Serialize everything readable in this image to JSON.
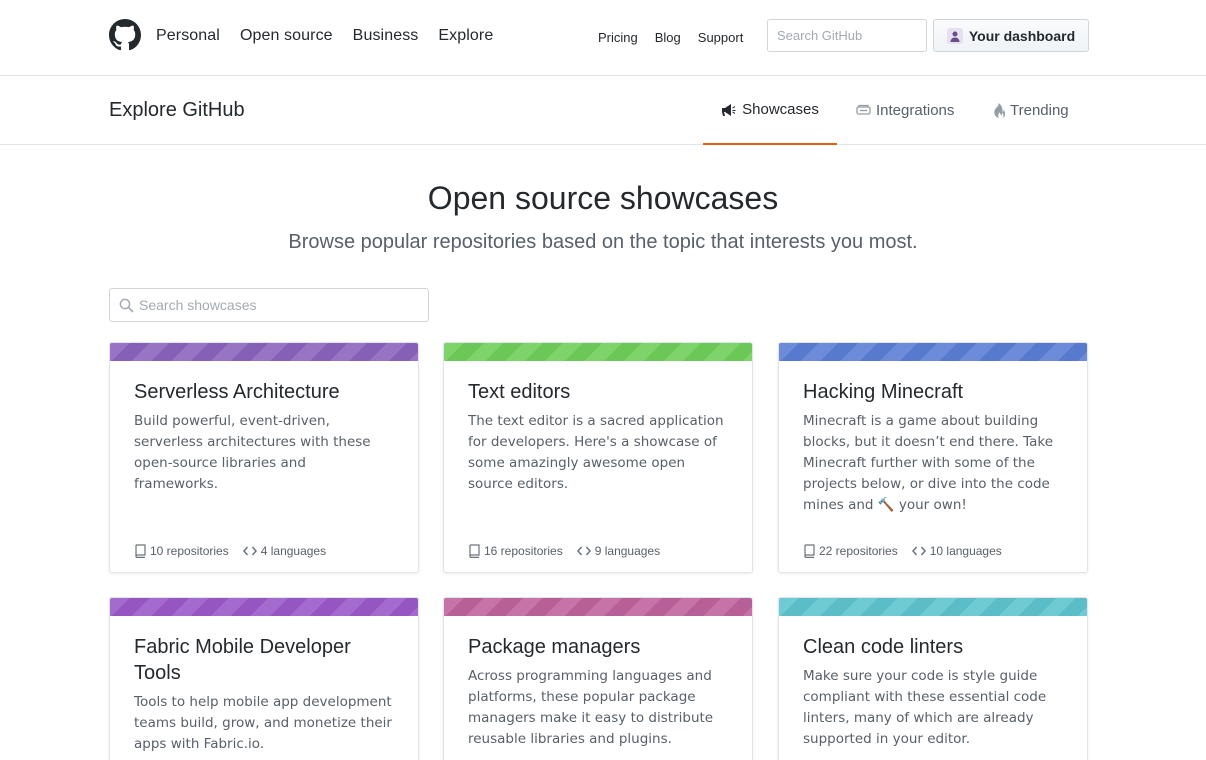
{
  "header": {
    "nav_main": [
      "Personal",
      "Open source",
      "Business",
      "Explore"
    ],
    "nav_sub": [
      "Pricing",
      "Blog",
      "Support"
    ],
    "search_placeholder": "Search GitHub",
    "dashboard_label": "Your dashboard"
  },
  "subnav": {
    "title": "Explore GitHub",
    "tabs": [
      {
        "label": "Showcases",
        "icon": "megaphone-icon",
        "active": true
      },
      {
        "label": "Integrations",
        "icon": "plug-icon",
        "active": false
      },
      {
        "label": "Trending",
        "icon": "flame-icon",
        "active": false
      }
    ]
  },
  "hero": {
    "title": "Open source showcases",
    "subtitle": "Browse popular repositories based on the topic that interests you most."
  },
  "showcase_search": {
    "placeholder": "Search showcases"
  },
  "cards": [
    {
      "title": "Serverless Architecture",
      "description": "Build powerful, event-driven, serverless architectures with these open-source libraries and frameworks.",
      "repositories": "10 repositories",
      "languages": "4 languages",
      "banner_color": "#8b64bd"
    },
    {
      "title": "Text editors",
      "description": "The text editor is a sacred application for developers. Here's a showcase of some amazingly awesome open source editors.",
      "repositories": "16 repositories",
      "languages": "9 languages",
      "banner_color": "#6fcf5a"
    },
    {
      "title": "Hacking Minecraft",
      "description": "Minecraft is a game about building blocks, but it doesn’t end there. Take Minecraft further with some of the projects below, or dive into the code mines and 🔨 your own!",
      "repositories": "22 repositories",
      "languages": "10 languages",
      "banner_color": "#5b7fd6"
    },
    {
      "title": "Fabric Mobile Developer Tools",
      "description": "Tools to help mobile app development teams build, grow, and monetize their apps with Fabric.io.",
      "banner_color": "#9b59c9"
    },
    {
      "title": "Package managers",
      "description": "Across programming languages and platforms, these popular package managers make it easy to distribute reusable libraries and plugins.",
      "banner_color": "#c0639e"
    },
    {
      "title": "Clean code linters",
      "description": "Make sure your code is style guide compliant with these essential code linters, many of which are already supported in your editor.",
      "banner_color": "#5ec5cf"
    }
  ],
  "colors": {
    "accent_tab": "#e36209",
    "text_primary": "#24292e",
    "text_muted": "#586069"
  }
}
